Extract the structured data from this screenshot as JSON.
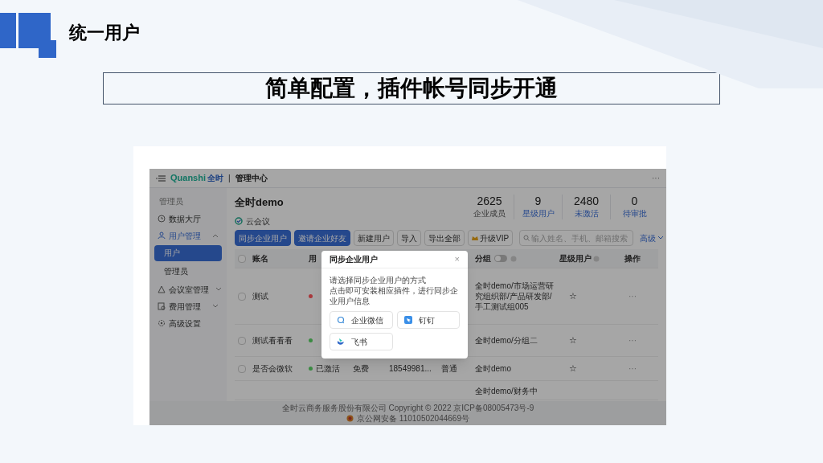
{
  "slide": {
    "section_title": "统一用户",
    "headline": "简单配置，插件帐号同步开通"
  },
  "app": {
    "top_bar": {
      "logo_latin": "Quanshi",
      "logo_cn": "全时",
      "separator": "|",
      "app_name": "管理中心",
      "more": "···"
    },
    "sidebar": {
      "heading": "管理员",
      "items": [
        {
          "label": "数据大厅",
          "selected": false
        },
        {
          "label": "用户管理",
          "selected": false,
          "expanded": true,
          "children": [
            {
              "label": "用户",
              "selected": true
            },
            {
              "label": "管理员",
              "selected": false
            }
          ]
        },
        {
          "label": "会议室管理",
          "selected": false,
          "expanded": false
        },
        {
          "label": "费用管理",
          "selected": false,
          "expanded": false
        },
        {
          "label": "高级设置",
          "selected": false
        }
      ]
    },
    "header": {
      "org": "全时demo",
      "product": "云会议",
      "stats": [
        {
          "value": "2625",
          "label": "企业成员",
          "highlighted": false
        },
        {
          "value": "9",
          "label": "星级用户",
          "highlighted": true
        },
        {
          "value": "2480",
          "label": "未激活",
          "highlighted": true
        },
        {
          "value": "0",
          "label": "待审批",
          "highlighted": true
        }
      ]
    },
    "toolbar": {
      "buttons": [
        {
          "label": "同步企业用户",
          "kind": "primary"
        },
        {
          "label": "邀请企业好友",
          "kind": "primary"
        },
        {
          "label": "新建用户",
          "kind": "default"
        },
        {
          "label": "导入",
          "kind": "default"
        },
        {
          "label": "导出全部",
          "kind": "default"
        },
        {
          "label": "升级VIP",
          "kind": "vip"
        }
      ],
      "search": {
        "placeholder": "输入姓名、手机、邮箱搜索"
      },
      "advanced": "高级"
    },
    "table": {
      "header": {
        "checked": false,
        "column_1": "账名",
        "column_2": "用",
        "group": "分组",
        "group_toggle_on": false,
        "star": "星级用户",
        "actions": "操作"
      },
      "rows": [
        {
          "checked": false,
          "name": "测试",
          "color": "#a8383c",
          "group": "全时demo/市场运营研究组织部/产品研发部/手工测试组005",
          "star": "☆",
          "actions": "···"
        },
        {
          "checked": false,
          "name": "测试看看看",
          "color": "#3a8a42",
          "group": "全时demo/分组二",
          "star": "☆",
          "actions": "···"
        },
        {
          "checked": false,
          "name": "是否会微软",
          "color": "#3a8a42",
          "status": "已激活",
          "plan": "免费",
          "phone": "18549981...",
          "role": "普通",
          "group": "全时demo",
          "star": "☆",
          "actions": "···"
        },
        {
          "group": "全时demo/财务中"
        }
      ]
    },
    "footer": {
      "copyright": "全时云商务服务股份有限公司 Copyright © 2022 京ICP备08005473号-9",
      "police": "京公网安备 11010502044669号"
    }
  },
  "dialog": {
    "title": "同步企业用户",
    "close": "×",
    "lines": [
      "请选择同步企业用户的方式",
      "点击即可安装相应插件，进行同步企业用户信息"
    ],
    "options": [
      {
        "label": "企业微信",
        "kind": "wecom"
      },
      {
        "label": "钉钉",
        "kind": "dingtalk"
      },
      {
        "label": "飞书",
        "kind": "feishu"
      }
    ]
  }
}
